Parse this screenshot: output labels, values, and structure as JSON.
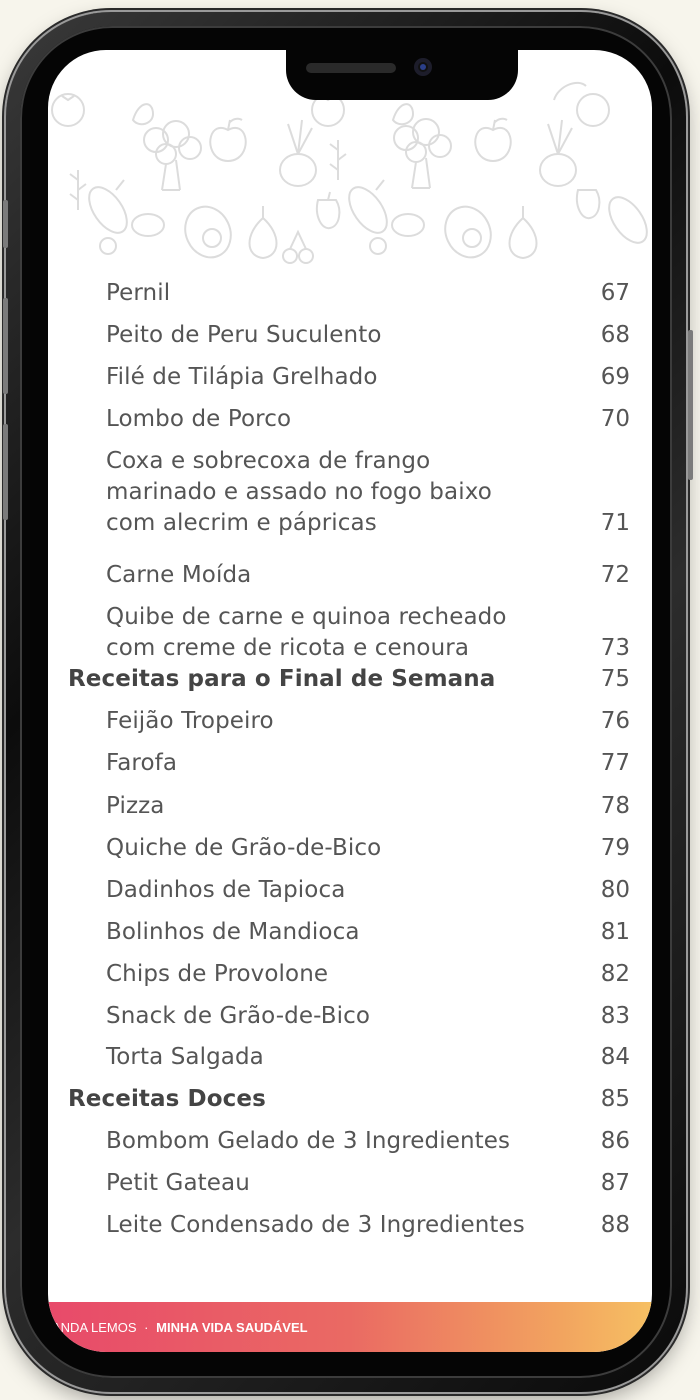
{
  "toc": [
    {
      "label": "Pernil",
      "page": "67",
      "level": "item"
    },
    {
      "label": "Peito de Peru Suculento",
      "page": "68",
      "level": "item"
    },
    {
      "label": "Filé de Tilápia Grelhado",
      "page": "69",
      "level": "item"
    },
    {
      "label": "Lombo de Porco",
      "page": "70",
      "level": "item"
    },
    {
      "label": "Coxa e sobrecoxa de frango\nmarinado e assado no fogo baixo\ncom alecrim e pápricas",
      "page": "71",
      "level": "item"
    },
    {
      "label": "Carne Moída",
      "page": "72",
      "level": "item"
    },
    {
      "label": "Quibe de carne e quinoa recheado\ncom creme de ricota e cenoura",
      "page": "73",
      "level": "item"
    },
    {
      "label": "Receitas para o Final de Semana",
      "page": "75",
      "level": "section"
    },
    {
      "label": "Feijão Tropeiro",
      "page": "76",
      "level": "item"
    },
    {
      "label": "Farofa",
      "page": "77",
      "level": "item"
    },
    {
      "label": "Pizza",
      "page": "78",
      "level": "item"
    },
    {
      "label": "Quiche de Grão-de-Bico",
      "page": "79",
      "level": "item"
    },
    {
      "label": "Dadinhos de Tapioca",
      "page": "80",
      "level": "item"
    },
    {
      "label": "Bolinhos de Mandioca",
      "page": "81",
      "level": "item"
    },
    {
      "label": "Chips de Provolone",
      "page": "82",
      "level": "item"
    },
    {
      "label": "Snack de Grão-de-Bico",
      "page": "83",
      "level": "item"
    },
    {
      "label": "Torta Salgada",
      "page": "84",
      "level": "item"
    },
    {
      "label": "Receitas Doces",
      "page": "85",
      "level": "section"
    },
    {
      "label": "Bombom Gelado de 3 Ingredientes",
      "page": "86",
      "level": "item"
    },
    {
      "label": "Petit Gateau",
      "page": "87",
      "level": "item"
    },
    {
      "label": "Leite Condensado de 3 Ingredientes",
      "page": "88",
      "level": "item"
    }
  ],
  "footer": {
    "author": "ANDA LEMOS",
    "separator": "·",
    "title": "MINHA VIDA SAUDÁVEL"
  },
  "colors": {
    "text": "#555555",
    "footer_start": "#e84a6a",
    "footer_end": "#f6c063",
    "pattern": "#d9d9d9"
  },
  "icons": [
    "phone-frame",
    "vegetable-pattern"
  ]
}
